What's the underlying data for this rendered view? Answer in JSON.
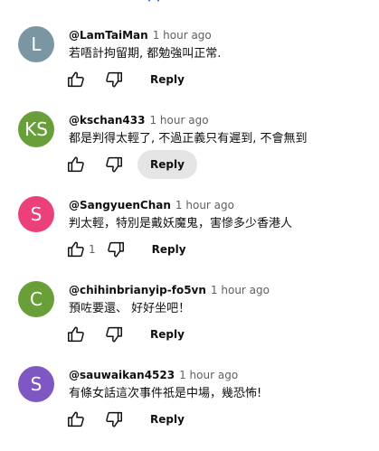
{
  "comments": [
    {
      "initial": "L",
      "avatar_color": "#7b96a3",
      "author": "@LamTaiMan",
      "time": "1 hour ago",
      "text": "若唔計拘留期, 都勉強叫正常.",
      "like_count": "",
      "reply_label": "Reply",
      "reply_hovered": false
    },
    {
      "initial": "KS",
      "avatar_color": "#689f38",
      "author": "@kschan433",
      "time": "1 hour ago",
      "text": "都是判得太輕了, 不過正義只有遲到, 不會無到",
      "like_count": "",
      "reply_label": "Reply",
      "reply_hovered": true
    },
    {
      "initial": "S",
      "avatar_color": "#ec407a",
      "author": "@SangyuenChan",
      "time": "1 hour ago",
      "text": "判太輕，特別是戴妖魔鬼，害慘多少香港人",
      "like_count": "1",
      "reply_label": "Reply",
      "reply_hovered": false
    },
    {
      "initial": "C",
      "avatar_color": "#689f38",
      "author": "@chihinbrianyip-fo5vn",
      "time": "1 hour ago",
      "text": "預咗要還、 好好坐吧！",
      "like_count": "",
      "reply_label": "Reply",
      "reply_hovered": false
    },
    {
      "initial": "S",
      "avatar_color": "#7e57c2",
      "author": "@sauwaikan4523",
      "time": "1 hour ago",
      "text": "有條女話這次事件祇是中場，幾恐怖!",
      "like_count": "",
      "reply_label": "Reply",
      "reply_hovered": false
    }
  ],
  "icons": {
    "like": "thumb-up-icon",
    "dislike": "thumb-down-icon"
  }
}
